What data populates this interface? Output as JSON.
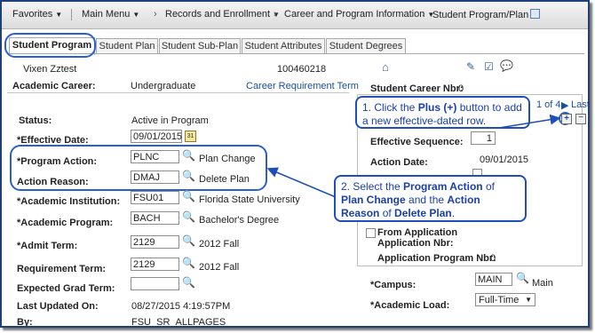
{
  "nav": {
    "favorites": "Favorites",
    "main_menu": "Main Menu",
    "records": "Records and Enrollment",
    "career": "Career and Program Information",
    "current": "Student Program/Plan"
  },
  "tabs": [
    "Student Program",
    "Student Plan",
    "Student Sub-Plan",
    "Student Attributes",
    "Student Degrees"
  ],
  "header": {
    "name": "Vixen Zztest",
    "id": "100460218",
    "career_label": "Academic Career:",
    "career_value": "Undergraduate",
    "career_req_link": "Career Requirement Term",
    "career_nbr_label": "Student Career Nbr:",
    "career_nbr_value": "0"
  },
  "pager": {
    "text": "1 of 4",
    "last": "Last"
  },
  "form": {
    "status_label": "Status:",
    "status_value": "Active in Program",
    "eff_date_label": "*Effective Date:",
    "eff_date_value": "09/01/2015",
    "program_action_label": "*Program Action:",
    "program_action_value": "PLNC",
    "program_action_desc": "Plan Change",
    "action_reason_label": "Action Reason:",
    "action_reason_value": "DMAJ",
    "action_reason_desc": "Delete Plan",
    "institution_label": "*Academic Institution:",
    "institution_value": "FSU01",
    "institution_desc": "Florida State University",
    "program_label": "*Academic Program:",
    "program_value": "BACH",
    "program_desc": "Bachelor's Degree",
    "admit_term_label": "*Admit Term:",
    "admit_term_value": "2129",
    "admit_term_desc": "2012 Fall",
    "req_term_label": "Requirement Term:",
    "req_term_value": "2129",
    "req_term_desc": "2012 Fall",
    "grad_term_label": "Expected Grad Term:",
    "grad_term_value": "",
    "last_updated_label": "Last Updated On:",
    "last_updated_value": "08/27/2015 4:19:57PM",
    "by_label": "By:",
    "by_value": "FSU_SR_ALLPAGES"
  },
  "right": {
    "eff_seq_label": "Effective Sequence:",
    "eff_seq_value": "1",
    "action_date_label": "Action Date:",
    "action_date_value": "09/01/2015",
    "from_app_label": "From Application",
    "app_nbr_label": "Application Nbr:",
    "app_prog_nbr_label": "Application Program Nbr:",
    "app_prog_nbr_value": "0",
    "campus_label": "*Campus:",
    "campus_value": "MAIN",
    "campus_desc": "Main",
    "load_label": "*Academic Load:",
    "load_value": "Full-Time"
  },
  "callouts": {
    "c1_pre": "1. Click the ",
    "c1_bold": "Plus (+)",
    "c1_post": " button to add a new effective-dated row.",
    "c2_pre": "2. Select the ",
    "c2_b1": "Program Action",
    "c2_mid1": " of ",
    "c2_b2": "Plan Change",
    "c2_mid2": " and the ",
    "c2_b3": "Action Reason",
    "c2_mid3": " of ",
    "c2_b4": "Delete Plan",
    "c2_post": "."
  },
  "colors": {
    "callout_blue": "#1f4fb8",
    "link_blue": "#1a4f9c",
    "nav_bg": "#e6e6e6"
  }
}
